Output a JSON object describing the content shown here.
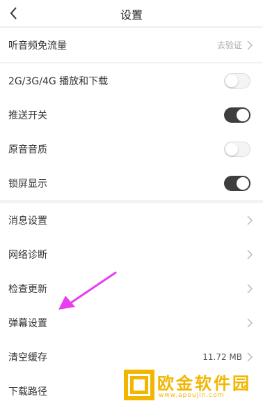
{
  "header": {
    "title": "设置"
  },
  "group1": {
    "free_traffic_label": "听音频免流量",
    "verify_text": "去验证"
  },
  "group2": {
    "items": [
      {
        "label": "2G/3G/4G 播放和下载",
        "on": false
      },
      {
        "label": "推送开关",
        "on": true
      },
      {
        "label": "原音音质",
        "on": false
      },
      {
        "label": "锁屏显示",
        "on": true
      }
    ]
  },
  "group3": {
    "message_settings": "消息设置",
    "network_diagnosis": "网络诊断",
    "check_update": "检查更新",
    "danmaku_settings": "弹幕设置",
    "clear_cache": "清空缓存",
    "cache_size": "11.72 MB",
    "download_path": "下载路径"
  },
  "watermark": {
    "title": "欧金软件园",
    "url": "www.apoujin.com"
  },
  "colors": {
    "toggle_on": "#3e3e3e",
    "toggle_off": "#f4f4f4",
    "arrow": "#e83df0",
    "watermark": "#f3b600"
  }
}
